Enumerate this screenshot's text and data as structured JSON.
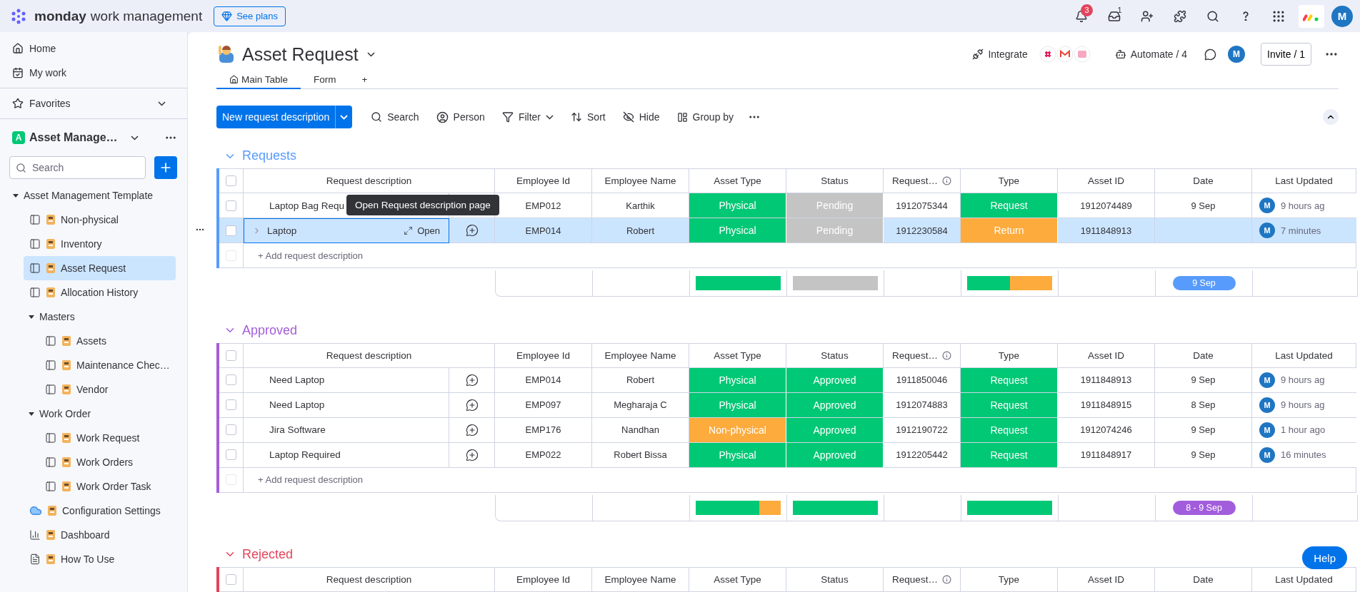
{
  "topbar": {
    "brand": "monday",
    "product": "work management",
    "plans_button": "See plans",
    "notifications_badge": "3",
    "inbox_badge": "1",
    "avatar": "M"
  },
  "sidebar": {
    "nav": [
      {
        "label": "Home",
        "kind": "home"
      },
      {
        "label": "My work",
        "kind": "mywork"
      }
    ],
    "favorites": "Favorites",
    "workspace": {
      "badge": "A",
      "name": "Asset Manage…"
    },
    "search": {
      "placeholder": "Search"
    },
    "tree": [
      {
        "label": "Asset Management Template",
        "kind": "folder",
        "expanded": true,
        "selected": false,
        "children": [
          {
            "label": "Non-physical",
            "kind": "board",
            "selected": false
          },
          {
            "label": "Inventory",
            "kind": "board",
            "selected": false
          },
          {
            "label": "Asset Request",
            "kind": "board",
            "selected": true
          },
          {
            "label": "Allocation History",
            "kind": "board",
            "selected": false
          },
          {
            "label": "Masters",
            "kind": "folder",
            "expanded": true,
            "selected": false,
            "children": [
              {
                "label": "Assets",
                "kind": "board",
                "selected": false
              },
              {
                "label": "Maintenance Chec…",
                "kind": "board",
                "selected": false
              },
              {
                "label": "Vendor",
                "kind": "board",
                "selected": false
              }
            ]
          },
          {
            "label": "Work Order",
            "kind": "folder",
            "expanded": true,
            "selected": false,
            "children": [
              {
                "label": "Work Request",
                "kind": "board",
                "selected": false
              },
              {
                "label": "Work Orders",
                "kind": "board",
                "selected": false
              },
              {
                "label": "Work Order Task",
                "kind": "board",
                "selected": false
              }
            ]
          },
          {
            "label": "Configuration Settings",
            "kind": "app",
            "selected": false
          },
          {
            "label": "Dashboard",
            "kind": "dashboard",
            "selected": false
          },
          {
            "label": "How To Use",
            "kind": "doc",
            "selected": false
          }
        ]
      }
    ]
  },
  "board": {
    "title": "Asset Request",
    "integrate": "Integrate",
    "automate": "Automate / 4",
    "avatar": "M",
    "invite": "Invite / 1",
    "tabs": [
      {
        "label": "Main Table",
        "selected": true
      },
      {
        "label": "Form",
        "selected": false
      }
    ],
    "add_tab": "+",
    "new_button": "New request description",
    "toolbar": [
      {
        "label": "Search",
        "kind": "search"
      },
      {
        "label": "Person",
        "kind": "person"
      },
      {
        "label": "Filter",
        "kind": "filter"
      },
      {
        "label": "Sort",
        "kind": "sort"
      },
      {
        "label": "Hide",
        "kind": "hide"
      },
      {
        "label": "Group by",
        "kind": "group"
      }
    ]
  },
  "groups": [
    {
      "title": "Requests",
      "color": "#579bfc",
      "header_checked": false,
      "tooltip": "Open Request description page",
      "columns": [
        {
          "label": "Request description",
          "info": false
        },
        {
          "label": "Employee Id",
          "info": false
        },
        {
          "label": "Employee Name",
          "info": false
        },
        {
          "label": "Asset Type",
          "info": false
        },
        {
          "label": "Status",
          "info": false
        },
        {
          "label": "Request…",
          "info": true
        },
        {
          "label": "Type",
          "info": false
        },
        {
          "label": "Asset ID",
          "info": false
        },
        {
          "label": "Date",
          "info": false
        },
        {
          "label": "Last Updated",
          "info": false
        }
      ],
      "rows": [
        {
          "description": "Laptop Bag Requ",
          "comment_icon": false,
          "selected": false,
          "checked": false,
          "employee_id": "EMP012",
          "employee_name": "Karthik",
          "asset_type": {
            "label": "Physical",
            "color": "#00c875"
          },
          "status": {
            "label": "Pending",
            "color": "#c4c4c4"
          },
          "request_id": "1912075344",
          "type": {
            "label": "Request",
            "color": "#00c875"
          },
          "asset_id": "1912074489",
          "date": "9 Sep",
          "updated_avatar": "M",
          "updated": "9 hours ag"
        },
        {
          "description": "Laptop",
          "open_label": "Open",
          "comment_icon": true,
          "selected": true,
          "checked": false,
          "employee_id": "EMP014",
          "employee_name": "Robert",
          "asset_type": {
            "label": "Physical",
            "color": "#00c875"
          },
          "status": {
            "label": "Pending",
            "color": "#c4c4c4"
          },
          "request_id": "1912230584",
          "type": {
            "label": "Return",
            "color": "#fdab3d"
          },
          "asset_id": "1911848913",
          "updated_avatar": "M",
          "updated": "7 minutes"
        }
      ],
      "add_row": "+ Add request description",
      "add_row_checkbox_disabled": true,
      "summary": {
        "asset_type": [
          {
            "color": "#00c875",
            "level": 1
          }
        ],
        "status": [
          {
            "color": "#c4c4c4",
            "level": 1
          }
        ],
        "type": [
          {
            "color": "#00c875",
            "level": 0.5
          },
          {
            "color": "#fdab3d",
            "level": 0.5
          }
        ],
        "date": {
          "label": "9 Sep",
          "color": "#579bfc"
        }
      }
    },
    {
      "title": "Approved",
      "color": "#a25ddc",
      "header_checked": false,
      "columns": [
        {
          "label": "Request description",
          "info": false
        },
        {
          "label": "Employee Id",
          "info": false
        },
        {
          "label": "Employee Name",
          "info": false
        },
        {
          "label": "Asset Type",
          "info": false
        },
        {
          "label": "Status",
          "info": false
        },
        {
          "label": "Request…",
          "info": true
        },
        {
          "label": "Type",
          "info": false
        },
        {
          "label": "Asset ID",
          "info": false
        },
        {
          "label": "Date",
          "info": false
        },
        {
          "label": "Last Updated",
          "info": false
        }
      ],
      "rows": [
        {
          "description": "Need Laptop",
          "comment_icon": true,
          "selected": false,
          "checked": false,
          "employee_id": "EMP014",
          "employee_name": "Robert",
          "asset_type": {
            "label": "Physical",
            "color": "#00c875"
          },
          "status": {
            "label": "Approved",
            "color": "#00c875"
          },
          "request_id": "1911850046",
          "type": {
            "label": "Request",
            "color": "#00c875"
          },
          "asset_id": "1911848913",
          "date": "9 Sep",
          "updated_avatar": "M",
          "updated": "9 hours ag"
        },
        {
          "description": "Need Laptop",
          "comment_icon": true,
          "selected": false,
          "checked": false,
          "employee_id": "EMP097",
          "employee_name": "Megharaja C",
          "asset_type": {
            "label": "Physical",
            "color": "#00c875"
          },
          "status": {
            "label": "Approved",
            "color": "#00c875"
          },
          "request_id": "1912074883",
          "type": {
            "label": "Request",
            "color": "#00c875"
          },
          "asset_id": "1911848915",
          "date": "8 Sep",
          "updated_avatar": "M",
          "updated": "9 hours ag"
        },
        {
          "description": "Jira Software",
          "comment_icon": true,
          "selected": false,
          "checked": false,
          "employee_id": "EMP176",
          "employee_name": "Nandhan",
          "asset_type": {
            "label": "Non-physical",
            "color": "#fdab3d"
          },
          "status": {
            "label": "Approved",
            "color": "#00c875"
          },
          "request_id": "1912190722",
          "type": {
            "label": "Request",
            "color": "#00c875"
          },
          "asset_id": "1912074246",
          "date": "9 Sep",
          "updated_avatar": "M",
          "updated": "1 hour ago"
        },
        {
          "description": "Laptop Required",
          "comment_icon": true,
          "selected": false,
          "checked": false,
          "employee_id": "EMP022",
          "employee_name": "Robert Bissa",
          "asset_type": {
            "label": "Physical",
            "color": "#00c875"
          },
          "status": {
            "label": "Approved",
            "color": "#00c875"
          },
          "request_id": "1912205442",
          "type": {
            "label": "Request",
            "color": "#00c875"
          },
          "asset_id": "1911848917",
          "date": "9 Sep",
          "updated_avatar": "M",
          "updated": "16 minutes"
        }
      ],
      "add_row": "+ Add request description",
      "add_row_checkbox_disabled": true,
      "summary": {
        "asset_type": [
          {
            "color": "#00c875",
            "level": 0.75
          },
          {
            "color": "#fdab3d",
            "level": 0.25
          }
        ],
        "status": [
          {
            "color": "#00c875",
            "level": 1
          }
        ],
        "type": [
          {
            "color": "#00c875",
            "level": 1
          }
        ],
        "date": {
          "label": "8 - 9 Sep",
          "color": "#a25ddc"
        }
      }
    },
    {
      "title": "Rejected",
      "color": "#e2445c",
      "header_checked": false,
      "columns": [
        {
          "label": "Request description",
          "info": false
        },
        {
          "label": "Employee Id",
          "info": false
        },
        {
          "label": "Employee Name",
          "info": false
        },
        {
          "label": "Asset Type",
          "info": false
        },
        {
          "label": "Status",
          "info": false
        },
        {
          "label": "Request…",
          "info": true
        },
        {
          "label": "Type",
          "info": false
        },
        {
          "label": "Asset ID",
          "info": false
        },
        {
          "label": "Date",
          "info": false
        },
        {
          "label": "Last Updated",
          "info": false
        }
      ]
    }
  ],
  "help": "Help"
}
